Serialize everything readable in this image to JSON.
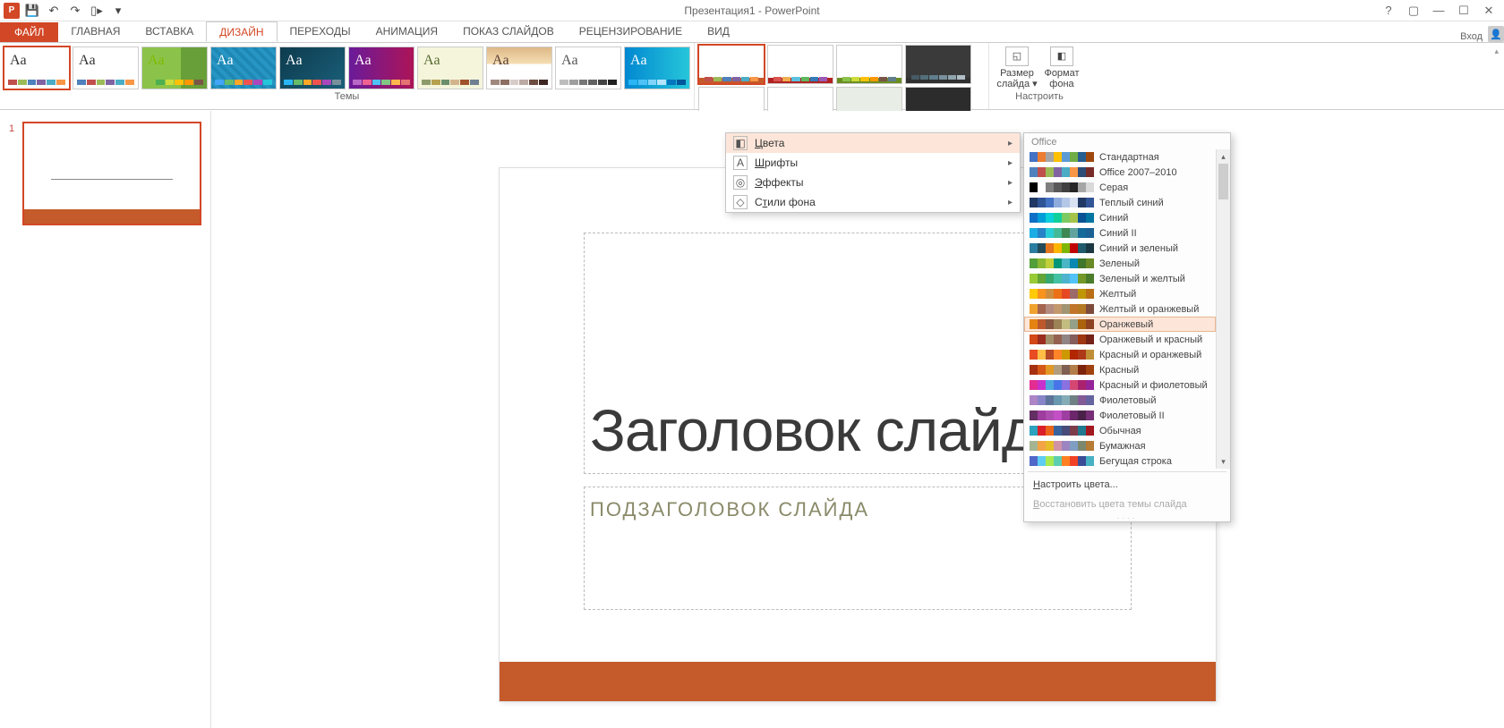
{
  "app": {
    "title": "Презентация1 - PowerPoint",
    "signin": "Вход"
  },
  "qat": {
    "save": "💾",
    "undo": "↶",
    "redo": "↷",
    "start": "▾"
  },
  "tabs": {
    "file": "ФАЙЛ",
    "items": [
      "ГЛАВНАЯ",
      "ВСТАВКА",
      "ДИЗАЙН",
      "ПЕРЕХОДЫ",
      "АНИМАЦИЯ",
      "ПОКАЗ СЛАЙДОВ",
      "РЕЦЕНЗИРОВАНИЕ",
      "ВИД"
    ],
    "active_index": 2
  },
  "ribbon": {
    "themes_label": "Темы",
    "customize_label": "Настроить",
    "slide_size": "Размер\nслайда ▾",
    "format_bg": "Формат\nфона",
    "themes": [
      {
        "aa": "Aa",
        "aa_color": "#333",
        "bg": "#fff",
        "dots": [
          "#c0504d",
          "#9bbb59",
          "#4f81bd",
          "#8064a2",
          "#4bacc6",
          "#f79646"
        ],
        "sel": true
      },
      {
        "aa": "Aa",
        "aa_color": "#333",
        "bg": "#fff",
        "dots": [
          "#4f81bd",
          "#c0504d",
          "#9bbb59",
          "#8064a2",
          "#4bacc6",
          "#f79646"
        ]
      },
      {
        "aa": "Aa",
        "aa_color": "#7fba00",
        "bg": "linear-gradient(90deg,#8bc34a 60%,#689f38 60%)",
        "dots": [
          "#8bc34a",
          "#4caf50",
          "#cddc39",
          "#ffc107",
          "#ff9800",
          "#795548"
        ]
      },
      {
        "aa": "Aa",
        "aa_color": "#fff",
        "bg": "repeating-linear-gradient(45deg,#1e88b5,#1e88b5 4px,#2896c4 4px,#2896c4 8px)",
        "dots": [
          "#42a5f5",
          "#66bb6a",
          "#ffa726",
          "#ef5350",
          "#ab47bc",
          "#26c6da"
        ]
      },
      {
        "aa": "Aa",
        "aa_color": "#fff",
        "bg": "linear-gradient(135deg,#0d3b4d,#1a5f7a)",
        "dots": [
          "#29b6f6",
          "#66bb6a",
          "#ffa726",
          "#ef5350",
          "#ab47bc",
          "#78909c"
        ]
      },
      {
        "aa": "Aa",
        "aa_color": "#fff",
        "bg": "linear-gradient(90deg,#6a1b9a,#ad1457)",
        "dots": [
          "#ba68c8",
          "#f06292",
          "#4fc3f7",
          "#81c784",
          "#ffb74d",
          "#e57373"
        ]
      },
      {
        "aa": "Aa",
        "aa_color": "#556b2f",
        "bg": "#f5f5dc",
        "dots": [
          "#8d9b6a",
          "#b5a14e",
          "#6b8e6b",
          "#d2b48c",
          "#a0522d",
          "#708090"
        ]
      },
      {
        "aa": "Aa",
        "aa_color": "#5d4037",
        "bg": "linear-gradient(#deb887,#f5deb3 40%,#fff 40%)",
        "dots": [
          "#a1887f",
          "#8d6e63",
          "#d7ccc8",
          "#bcaaa4",
          "#6d4c41",
          "#3e2723"
        ]
      },
      {
        "aa": "Aa",
        "aa_color": "#555",
        "bg": "#fff",
        "dots": [
          "#bdbdbd",
          "#9e9e9e",
          "#757575",
          "#616161",
          "#424242",
          "#212121"
        ]
      },
      {
        "aa": "Aa",
        "aa_color": "#fff",
        "bg": "linear-gradient(90deg,#0288d1,#26c6da)",
        "dots": [
          "#29b6f6",
          "#4fc3f7",
          "#81d4fa",
          "#b3e5fc",
          "#0277bd",
          "#01579b"
        ]
      }
    ],
    "variants": [
      {
        "bar": "#c55a2a",
        "dots": [
          "#c0504d",
          "#9bbb59",
          "#4f81bd",
          "#8064a2",
          "#4bacc6",
          "#f79646"
        ],
        "sel": true
      },
      {
        "bar": "#b22222",
        "dots": [
          "#d9534f",
          "#f0ad4e",
          "#5bc0de",
          "#5cb85c",
          "#337ab7",
          "#9b59b6"
        ]
      },
      {
        "bar": "#6b8e23",
        "dots": [
          "#8bc34a",
          "#cddc39",
          "#ffc107",
          "#ff9800",
          "#795548",
          "#607d8b"
        ]
      },
      {
        "bar": "#303030",
        "dots": [
          "#455a64",
          "#546e7a",
          "#607d8b",
          "#78909c",
          "#90a4ae",
          "#b0bec5"
        ],
        "dark": true
      },
      {
        "bar": "",
        "dots": [
          "#26c6da",
          "#29b6f6",
          "#42a5f5",
          "#5c6bc0",
          "#7e57c2",
          "#ab47bc"
        ],
        "bottom": true
      },
      {
        "bar": "",
        "dots": [
          "#ef5350",
          "#f44336",
          "#e53935",
          "#d32f2f",
          "#c62828",
          "#b71c1c"
        ],
        "bottom": true,
        "underline": "#b22222"
      },
      {
        "bar": "",
        "dots": [
          "#9ccc65",
          "#aed581",
          "#c5e1a5",
          "#dcedc8",
          "#8bc34a",
          "#7cb342"
        ],
        "bg": "#e8eee5"
      },
      {
        "bar": "",
        "dots": [
          "#5c6bc0",
          "#3f51b5",
          "#3949ab",
          "#303f9f",
          "#283593",
          "#1a237e"
        ],
        "bg": "#2c2c2c"
      }
    ]
  },
  "variants_menu": [
    {
      "icon": "◧",
      "label": "Цвета",
      "has_sub": true,
      "hover": true,
      "underline": 0
    },
    {
      "icon": "A",
      "label": "Шрифты",
      "has_sub": true,
      "underline": 0
    },
    {
      "icon": "◎",
      "label": "Эффекты",
      "has_sub": true,
      "underline": 0
    },
    {
      "icon": "◇",
      "label": "Стили фона",
      "has_sub": true,
      "underline": 1
    }
  ],
  "colors_menu": {
    "header": "Office",
    "customize": "Настроить цвета...",
    "reset": "Восстановить цвета темы слайда",
    "schemes": [
      {
        "name": "Стандартная",
        "c": [
          "#4472c4",
          "#ed7d31",
          "#a5a5a5",
          "#ffc000",
          "#5b9bd5",
          "#70ad47",
          "#255e91",
          "#9e480e"
        ]
      },
      {
        "name": "Office 2007–2010",
        "c": [
          "#4f81bd",
          "#c0504d",
          "#9bbb59",
          "#8064a2",
          "#4bacc6",
          "#f79646",
          "#2c4d75",
          "#772c2a"
        ]
      },
      {
        "name": "Серая",
        "c": [
          "#000",
          "#fff",
          "#7f7f7f",
          "#595959",
          "#404040",
          "#262626",
          "#a6a6a6",
          "#d9d9d9"
        ]
      },
      {
        "name": "Теплый синий",
        "c": [
          "#1f3864",
          "#2f5496",
          "#4472c4",
          "#8faadc",
          "#b4c7e7",
          "#d9e2f3",
          "#203864",
          "#305496"
        ]
      },
      {
        "name": "Синий",
        "c": [
          "#0f6fc6",
          "#009dd9",
          "#0bd0d9",
          "#10cf9b",
          "#7cca62",
          "#a5c249",
          "#0a5294",
          "#0075a2"
        ]
      },
      {
        "name": "Синий II",
        "c": [
          "#1cade4",
          "#2683c6",
          "#27ced7",
          "#42ba97",
          "#3e8853",
          "#62a39f",
          "#156a9a",
          "#1c6194"
        ]
      },
      {
        "name": "Синий и зеленый",
        "c": [
          "#2c7c9f",
          "#244a58",
          "#e2751d",
          "#ffb400",
          "#7eb606",
          "#c00000",
          "#215a6c",
          "#1b3742"
        ]
      },
      {
        "name": "Зеленый",
        "c": [
          "#549e39",
          "#8ab833",
          "#c0cf3a",
          "#029676",
          "#4ab5c4",
          "#0989b1",
          "#3f762b",
          "#688926"
        ]
      },
      {
        "name": "Зеленый и желтый",
        "c": [
          "#99cb38",
          "#63a537",
          "#37a76f",
          "#44c1a3",
          "#4eb3cf",
          "#51c3f9",
          "#739728",
          "#4a7c29"
        ]
      },
      {
        "name": "Желтый",
        "c": [
          "#ffca08",
          "#f8931d",
          "#ce8d3e",
          "#ec7016",
          "#e64823",
          "#9c6a6a",
          "#bf9706",
          "#ba6e16"
        ]
      },
      {
        "name": "Желтый и оранжевый",
        "c": [
          "#f0a22e",
          "#a5644e",
          "#b58b80",
          "#c3986d",
          "#a19574",
          "#c17529",
          "#b47922",
          "#7c4b3b"
        ]
      },
      {
        "name": "Оранжевый",
        "hover": true,
        "c": [
          "#e48312",
          "#bd582c",
          "#865640",
          "#9b8357",
          "#c2bc80",
          "#94a088",
          "#ab620d",
          "#8e4221"
        ]
      },
      {
        "name": "Оранжевый и красный",
        "c": [
          "#d34817",
          "#9b2d1f",
          "#a28e6a",
          "#956251",
          "#918485",
          "#855d5d",
          "#9e3611",
          "#742217"
        ]
      },
      {
        "name": "Красный и оранжевый",
        "c": [
          "#e84c22",
          "#ffbd47",
          "#b64926",
          "#ff8427",
          "#cc9900",
          "#b22600",
          "#ae3919",
          "#bf8e35"
        ]
      },
      {
        "name": "Красный",
        "c": [
          "#a5300f",
          "#d55816",
          "#e19825",
          "#b19c7d",
          "#7f5f52",
          "#b27d49",
          "#7c240b",
          "#a04210"
        ]
      },
      {
        "name": "Красный и фиолетовый",
        "c": [
          "#e32d91",
          "#c830cc",
          "#4ea6dc",
          "#4775e7",
          "#8971e1",
          "#d54773",
          "#aa226d",
          "#962499"
        ]
      },
      {
        "name": "Фиолетовый",
        "c": [
          "#ad84c6",
          "#8784c7",
          "#5d739a",
          "#6997af",
          "#84acb6",
          "#6f8183",
          "#825a95",
          "#6563a0"
        ]
      },
      {
        "name": "Фиолетовый II",
        "c": [
          "#632e62",
          "#9d3d9d",
          "#ae4db0",
          "#c34fc5",
          "#9d3fa0",
          "#6b276a",
          "#4a2249",
          "#762e76"
        ]
      },
      {
        "name": "Обычная",
        "c": [
          "#2da2bf",
          "#da1f28",
          "#eb641b",
          "#39639d",
          "#474b78",
          "#7d3c4a",
          "#21798f",
          "#a3171e"
        ]
      },
      {
        "name": "Бумажная",
        "c": [
          "#a5b592",
          "#f3a447",
          "#e7bc29",
          "#d092a7",
          "#9c85c0",
          "#809ec2",
          "#7c886e",
          "#b67b35"
        ]
      },
      {
        "name": "Бегущая строка",
        "c": [
          "#4e67c8",
          "#5eccf3",
          "#a7ea52",
          "#5dceaf",
          "#ff8021",
          "#f14124",
          "#3a4d96",
          "#46b1c2"
        ]
      }
    ]
  },
  "slide": {
    "number": "1",
    "title": "Заголовок слайда",
    "subtitle": "Подзаголовок слайда"
  }
}
